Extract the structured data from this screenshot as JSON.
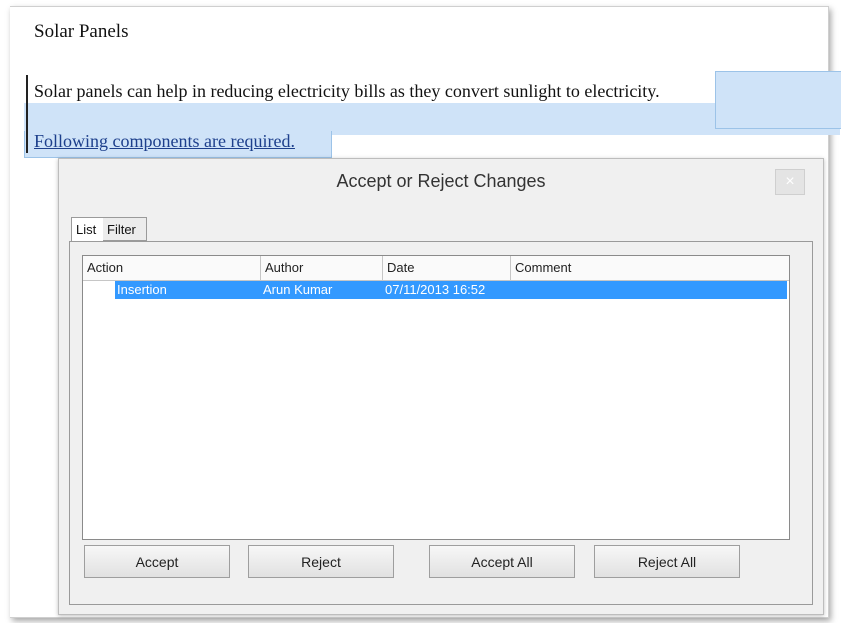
{
  "document": {
    "title": "Solar Panels",
    "paragraph1": "Solar panels can help in reducing electricity bills as they convert sunlight to electricity.",
    "paragraph2": "Following components are required."
  },
  "dialog": {
    "title": "Accept or Reject Changes",
    "close_label": "×",
    "tabs": [
      {
        "label": "List"
      },
      {
        "label": "Filter"
      }
    ],
    "columns": {
      "action": "Action",
      "author": "Author",
      "date": "Date",
      "comment": "Comment"
    },
    "rows": [
      {
        "action": "Insertion",
        "author": "Arun Kumar",
        "date": "07/11/2013 16:52",
        "comment": ""
      }
    ],
    "buttons": {
      "accept": "Accept",
      "reject": "Reject",
      "accept_all": "Accept All",
      "reject_all": "Reject All"
    }
  },
  "colors": {
    "selection": "#3399ff",
    "tracked_change_highlight": "#cfe3f8",
    "tracked_change_text": "#1d3f8c"
  }
}
